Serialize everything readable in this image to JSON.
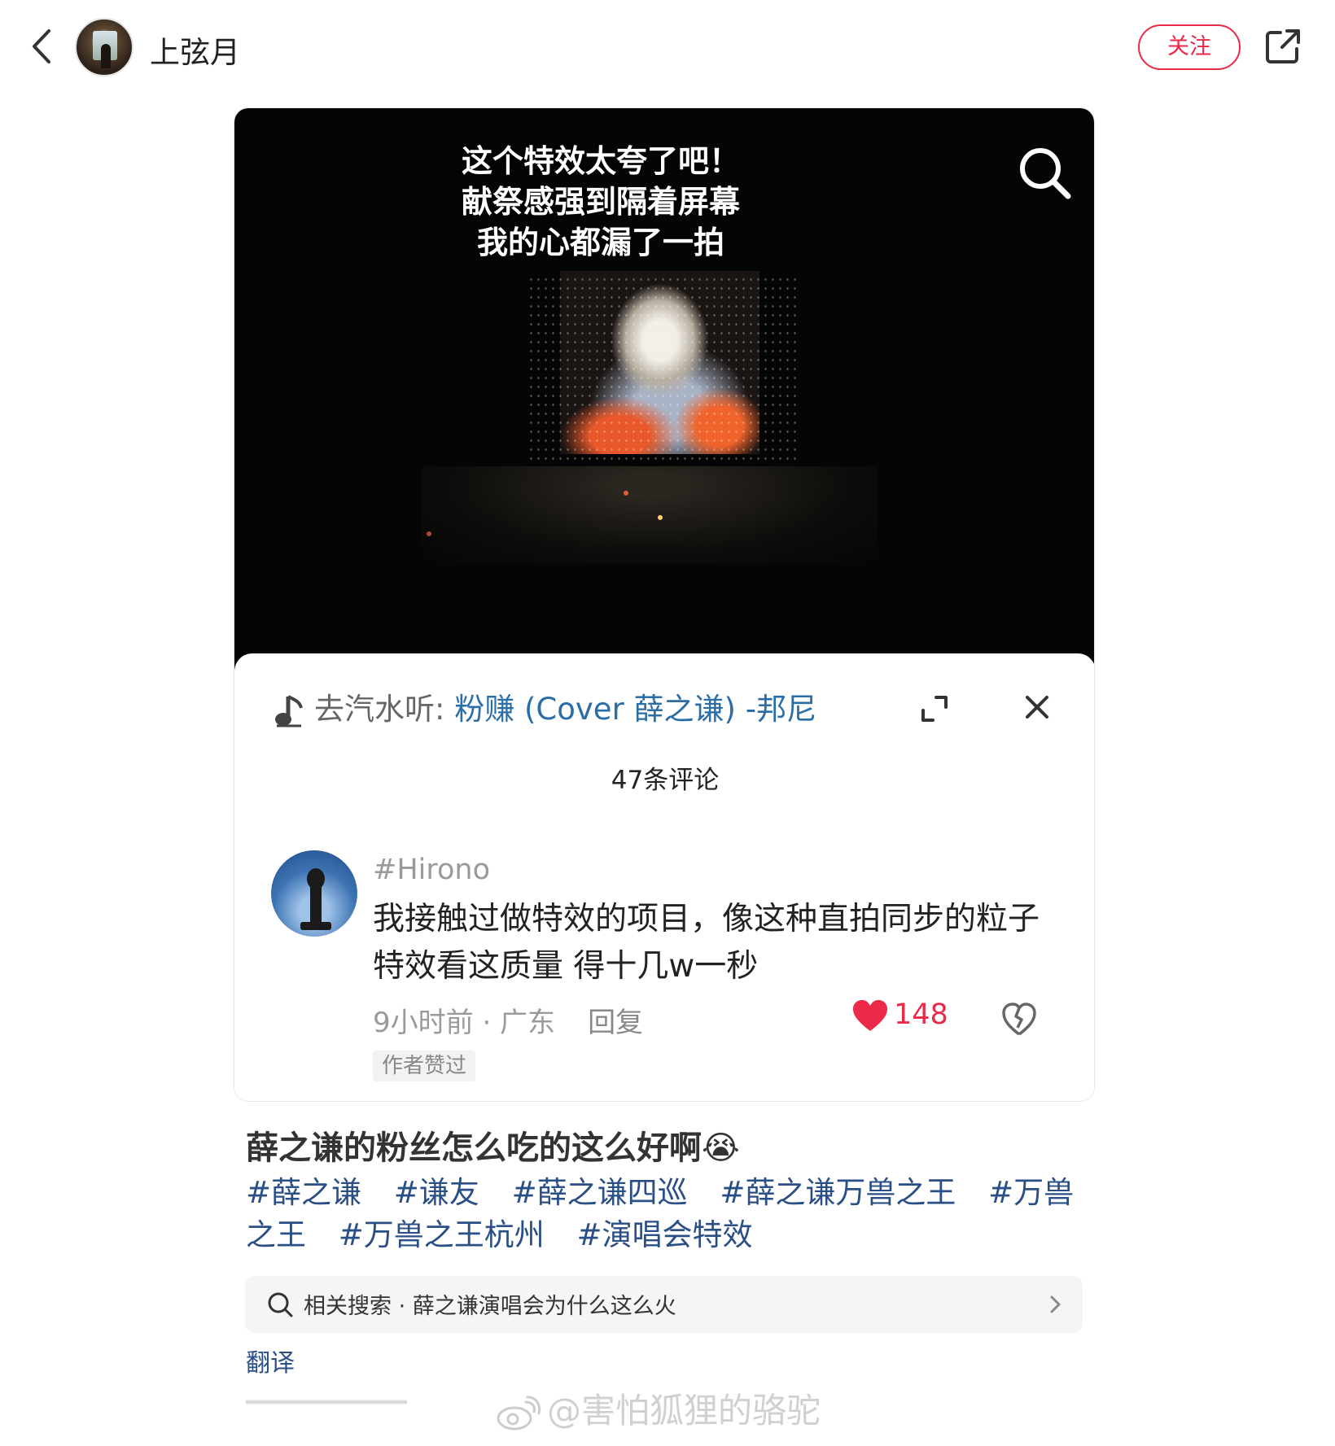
{
  "header": {
    "username": "上弦月",
    "follow_label": "关注"
  },
  "video": {
    "caption_lines": [
      "这个特效太夸了吧！",
      "献祭感强到隔着屏幕",
      "我的心都漏了一拍"
    ]
  },
  "sheet": {
    "music_prefix": "去汽水听: ",
    "music_song": "粉赚 (Cover 薛之谦) -邦尼",
    "comment_count": "47条评论",
    "comment": {
      "author": "#Hirono",
      "text": "我接触过做特效的项目，像这种直拍同步的粒子特效看这质量 得十几w一秒",
      "time_location": "9小时前 · 广东",
      "reply_label": "回复",
      "likes": "148",
      "badge": "作者赞过"
    }
  },
  "post": {
    "title": "薛之谦的粉丝怎么吃的这么好啊😭",
    "tags": [
      "#薛之谦",
      "#谦友",
      "#薛之谦四巡",
      "#薛之谦万兽之王",
      "#万兽之王",
      "#万兽之王杭州",
      "#演唱会特效"
    ],
    "related_search": "相关搜索 · 薛之谦演唱会为什么这么火",
    "translate_label": "翻译"
  },
  "watermark": "@害怕狐狸的骆驼",
  "colors": {
    "accent_red": "#ea2a48",
    "link_blue": "#2a4f86",
    "music_blue": "#2a6ea8"
  }
}
